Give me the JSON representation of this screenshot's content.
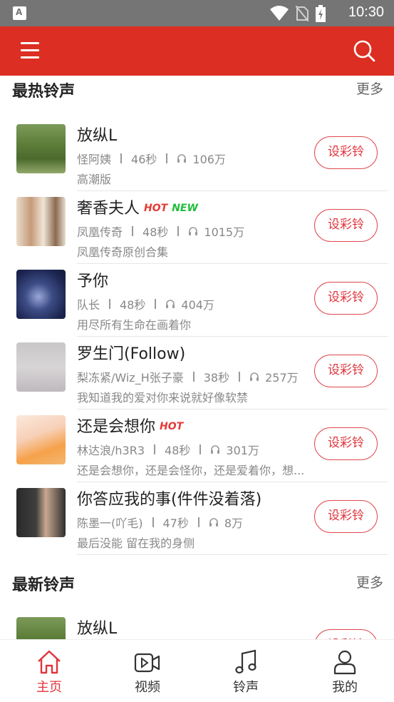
{
  "status_bar": {
    "time": "10:30"
  },
  "sections": [
    {
      "title": "最热铃声",
      "more": "更多",
      "items": [
        {
          "title": "放纵L",
          "badges": [],
          "artist": "怪阿姨",
          "duration": "46秒",
          "plays": "106万",
          "desc": "高潮版",
          "button": "设彩铃"
        },
        {
          "title": "奢香夫人",
          "badges": [
            "HOT",
            "NEW"
          ],
          "artist": "凤凰传奇",
          "duration": "48秒",
          "plays": "1015万",
          "desc": "凤凰传奇原创合集",
          "button": "设彩铃"
        },
        {
          "title": "予你",
          "badges": [],
          "artist": "队长",
          "duration": "48秒",
          "plays": "404万",
          "desc": "用尽所有生命在画着你",
          "button": "设彩铃"
        },
        {
          "title": "罗生门(Follow)",
          "badges": [],
          "artist": "梨冻紧/Wiz_H张子豪",
          "duration": "38秒",
          "plays": "257万",
          "desc": "我知道我的爱对你来说就好像软禁",
          "button": "设彩铃"
        },
        {
          "title": "还是会想你",
          "badges": [
            "HOT"
          ],
          "artist": "林达浪/h3R3",
          "duration": "48秒",
          "plays": "301万",
          "desc": "还是会想你，还是会怪你，还是爱着你，想...",
          "button": "设彩铃"
        },
        {
          "title": "你答应我的事(件件没着落)",
          "badges": [],
          "artist": "陈墨一(吖毛)",
          "duration": "47秒",
          "plays": "8万",
          "desc": "最后没能 留在我的身侧",
          "button": "设彩铃"
        }
      ]
    },
    {
      "title": "最新铃声",
      "more": "更多",
      "items": [
        {
          "title": "放纵L",
          "badges": [],
          "artist": "",
          "duration": "",
          "plays": "",
          "desc": "",
          "button": "设彩铃"
        }
      ]
    }
  ],
  "tabs": [
    {
      "label": "主页",
      "icon": "home-icon",
      "active": true
    },
    {
      "label": "视频",
      "icon": "video-icon",
      "active": false
    },
    {
      "label": "铃声",
      "icon": "music-note-icon",
      "active": false
    },
    {
      "label": "我的",
      "icon": "user-icon",
      "active": false
    }
  ],
  "colors": {
    "brand": "#dc2e22",
    "accent": "#e0353c",
    "hot": "#e53935",
    "new": "#1fbf3a",
    "status_bar": "#757575"
  }
}
